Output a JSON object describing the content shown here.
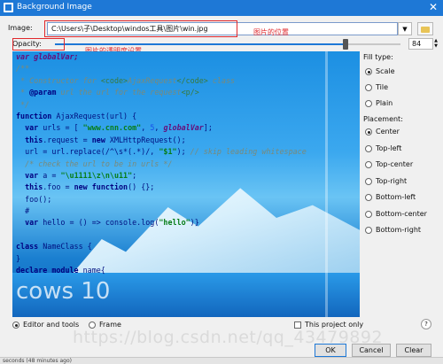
{
  "window": {
    "title": "Background Image",
    "close_glyph": "✕",
    "icon": "app-icon"
  },
  "image_row": {
    "label": "Image:",
    "value": "C:\\Users\\子\\Desktop\\windos工具\\图片\\win.jpg",
    "dropdown_glyph": "▼",
    "browse_icon": "folder-icon"
  },
  "opacity_row": {
    "label": "Opacity:",
    "value": "84",
    "percent": 84
  },
  "annotations": {
    "image_note": "图片的位置",
    "opacity_note": "图片的透明度设置"
  },
  "code_lines": [
    [
      [
        "gv",
        "var globalVar;"
      ]
    ],
    [
      [
        "cm",
        "/**"
      ]
    ],
    [
      [
        "cm",
        " * Constructor for "
      ],
      [
        "tg",
        "<code>"
      ],
      [
        "cm",
        "AjaxRequest"
      ],
      [
        "tg",
        "</code>"
      ],
      [
        "cm",
        " class"
      ]
    ],
    [
      [
        "cm",
        " * "
      ],
      [
        "kw",
        "@param"
      ],
      [
        "cm",
        " url the url for the request"
      ],
      [
        "tg",
        "<p/>"
      ]
    ],
    [
      [
        "cm",
        " */"
      ]
    ],
    [
      [
        "kw",
        "function "
      ],
      [
        "",
        "AjaxRequest(url) {"
      ]
    ],
    [
      [
        "kw",
        "  var "
      ],
      [
        "",
        "urls = [ "
      ],
      [
        "st",
        "\"www.cnn.com\""
      ],
      [
        "",
        ", "
      ],
      [
        "nm",
        "5"
      ],
      [
        "",
        ", "
      ],
      [
        "gv",
        "globalVar"
      ],
      [
        "",
        "];"
      ]
    ],
    [
      [
        "kw",
        "  this"
      ],
      [
        "",
        ".request = "
      ],
      [
        "kw",
        "new "
      ],
      [
        "",
        "XMLHttpRequest();"
      ]
    ],
    [
      [
        "",
        "  url = url.replace(/^\\s*(.*)/, "
      ],
      [
        "st",
        "\"$1\""
      ],
      [
        "",
        "); "
      ],
      [
        "cm",
        "// skip leading whitespace"
      ]
    ],
    [
      [
        "cm",
        "  /* check the url to be in urls */"
      ]
    ],
    [
      [
        "kw",
        "  var "
      ],
      [
        "",
        "a = "
      ],
      [
        "st",
        "\"\\u1111\\z\\n\\u11\""
      ],
      [
        "",
        ";"
      ]
    ],
    [
      [
        "kw",
        "  this"
      ],
      [
        "",
        ".foo = "
      ],
      [
        "kw",
        "new function"
      ],
      [
        "",
        "() {};"
      ]
    ],
    [
      [
        "",
        "  foo();"
      ]
    ],
    [
      [
        "",
        "  #"
      ]
    ],
    [
      [
        "kw",
        "  var "
      ],
      [
        "",
        "hello = () => console.log("
      ],
      [
        "st",
        "\"hello\""
      ],
      [
        "",
        ")}"
      ]
    ],
    [
      [
        "",
        ""
      ]
    ],
    [
      [
        "kw",
        "class "
      ],
      [
        "",
        "NameClass {"
      ]
    ],
    [
      [
        "",
        "}"
      ]
    ],
    [
      [
        "kw",
        "declare module "
      ],
      [
        "",
        "name{"
      ]
    ]
  ],
  "preview": {
    "logo_text": "cows 10"
  },
  "fill_type": {
    "label": "Fill type:",
    "options": [
      "Scale",
      "Tile",
      "Plain"
    ],
    "selected": "Scale"
  },
  "placement": {
    "label": "Placement:",
    "options": [
      "Center",
      "Top-left",
      "Top-center",
      "Top-right",
      "Bottom-left",
      "Bottom-center",
      "Bottom-right"
    ],
    "selected": "Center"
  },
  "scope": {
    "options": [
      "Editor and tools",
      "Frame"
    ],
    "selected": "Editor and tools"
  },
  "this_project_only": {
    "label": "This project only",
    "checked": false
  },
  "help_glyph": "?",
  "buttons": {
    "ok": "OK",
    "cancel": "Cancel",
    "clear": "Clear"
  },
  "status_text": "seconds (48 minutes ago)",
  "watermark": "https://blog.csdn.net/qq_43479892",
  "colors": {
    "accent": "#1e78d6",
    "annotation": "#e0282c"
  }
}
